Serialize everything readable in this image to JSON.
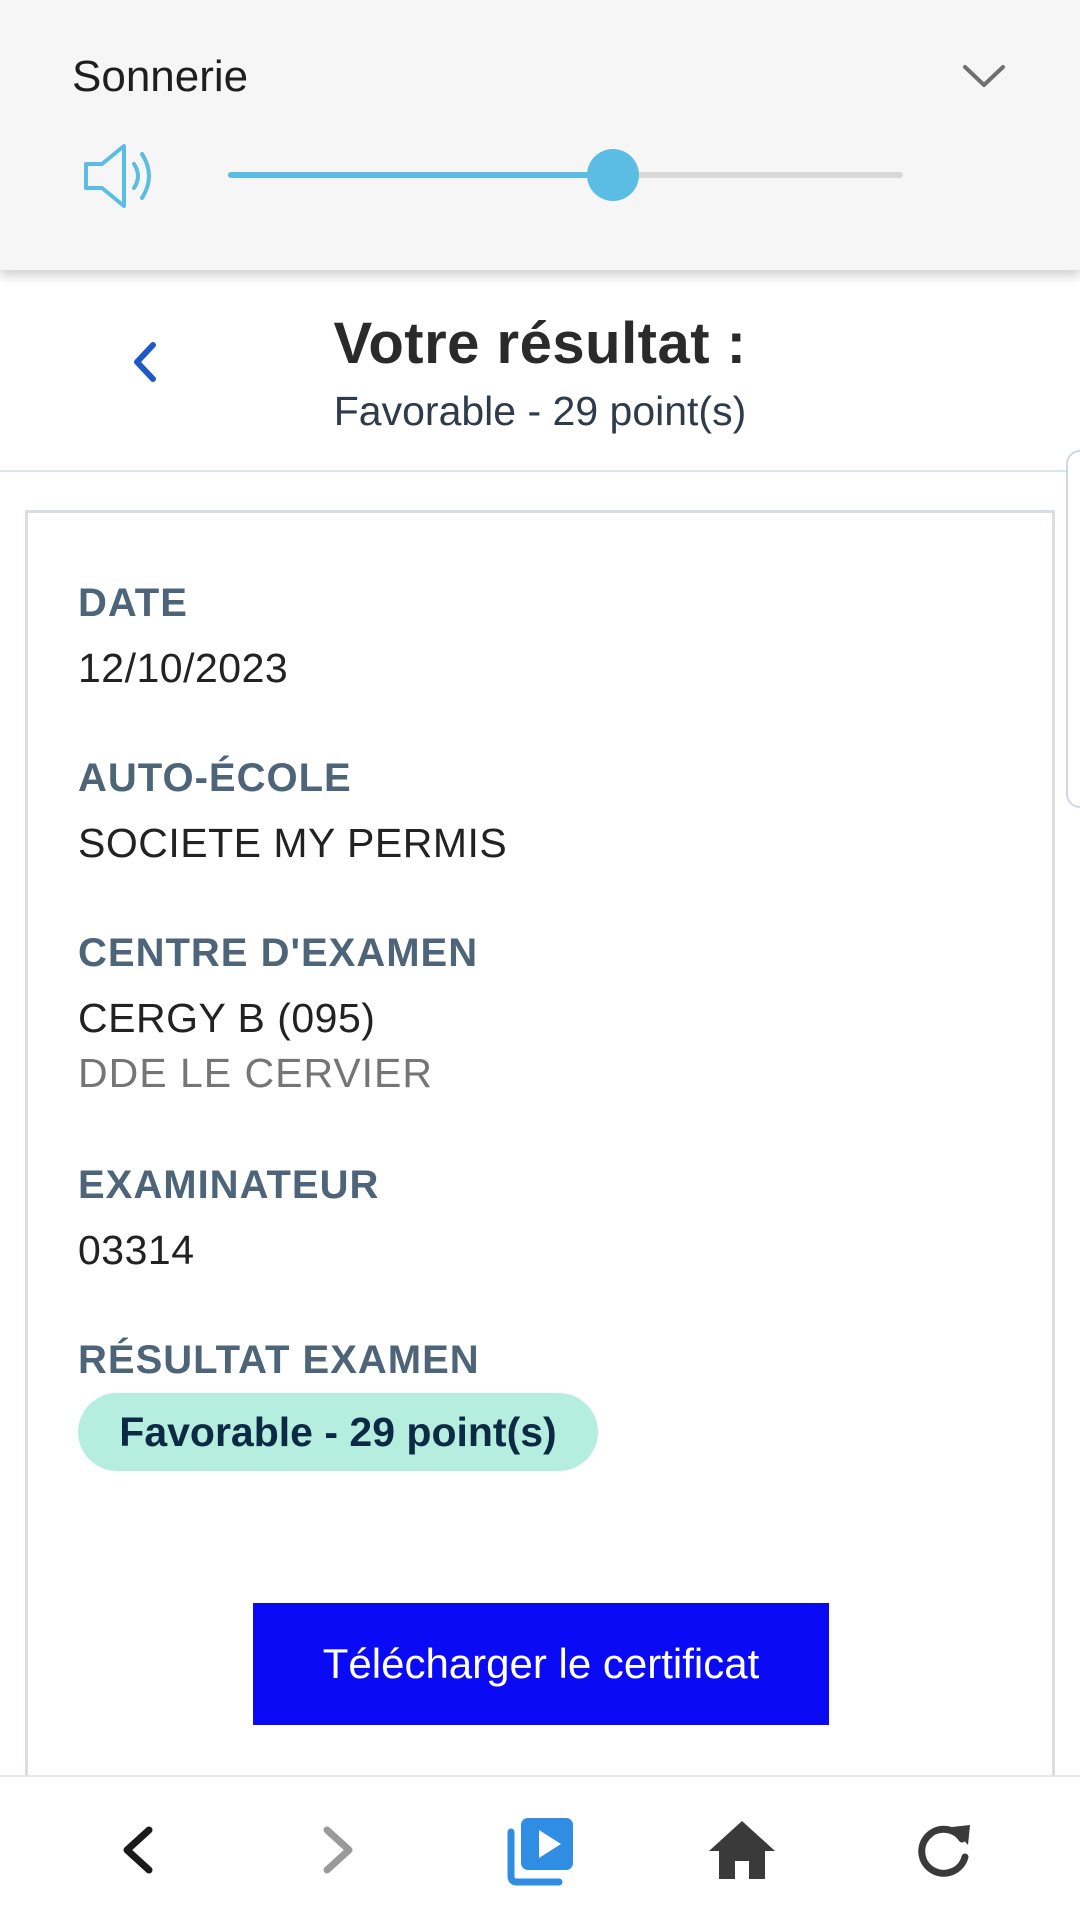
{
  "volume_panel": {
    "title": "Sonnerie",
    "level": 0.57,
    "accent_color": "#5bbde3",
    "icons": {
      "speaker": "speaker-icon",
      "expand": "chevron-down-icon"
    }
  },
  "header": {
    "title": "Votre résultat :",
    "subtitle": "Favorable - 29 point(s)",
    "back_icon": "chevron-left-icon"
  },
  "details": {
    "date_label": "DATE",
    "date_value": "12/10/2023",
    "school_label": "AUTO-ÉCOLE",
    "school_value": "SOCIETE MY PERMIS",
    "center_label": "CENTRE D'EXAMEN",
    "center_value": "CERGY B (095)",
    "center_sub": "DDE LE CERVIER",
    "examiner_label": "EXAMINATEUR",
    "examiner_value": "03314",
    "result_label": "RÉSULTAT EXAMEN",
    "result_badge": "Favorable - 29 point(s)",
    "badge_color": "#b5eedf"
  },
  "actions": {
    "download_label": "Télécharger le certificat",
    "button_color": "#0a0af5"
  },
  "toolbar": {
    "icons": [
      "back-arrow-icon",
      "forward-arrow-icon",
      "media-player-icon",
      "home-icon",
      "reload-icon"
    ]
  }
}
